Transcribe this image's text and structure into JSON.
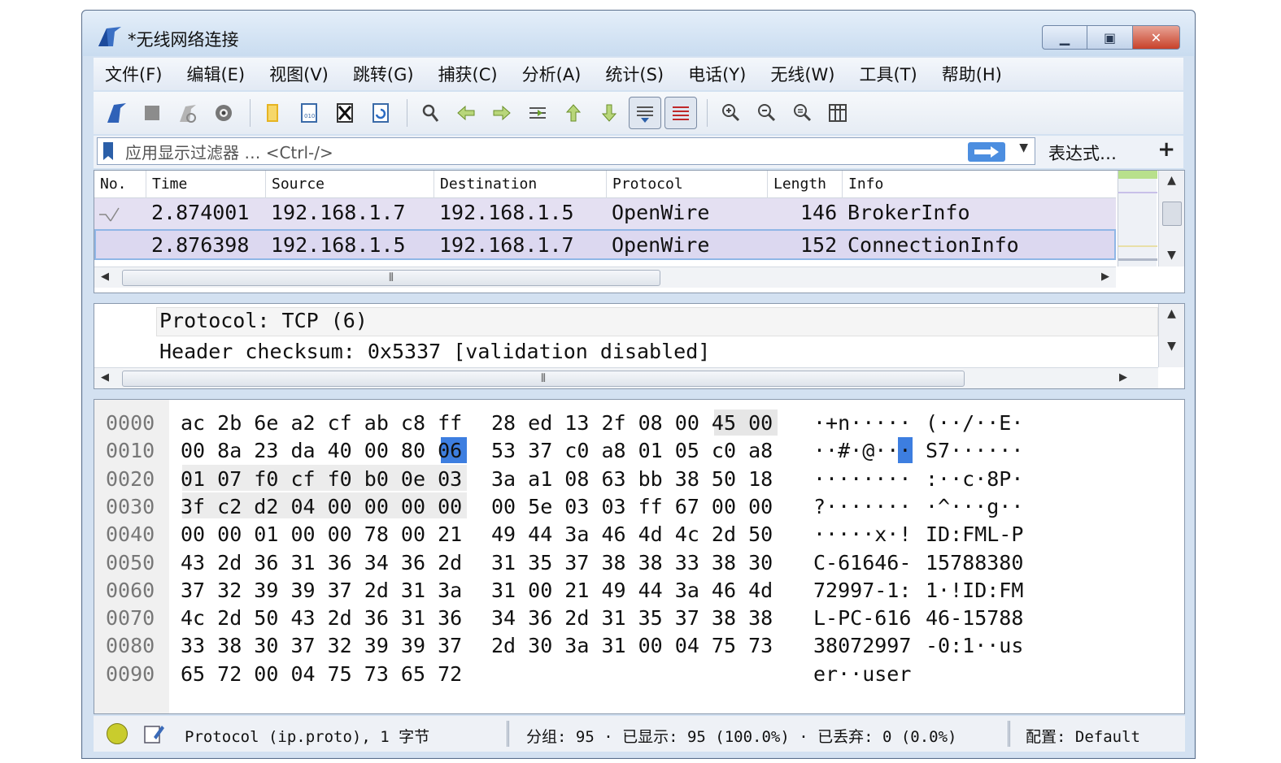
{
  "window": {
    "title": "*无线网络连接"
  },
  "menu": [
    "文件(F)",
    "编辑(E)",
    "视图(V)",
    "跳转(G)",
    "捕获(C)",
    "分析(A)",
    "统计(S)",
    "电话(Y)",
    "无线(W)",
    "工具(T)",
    "帮助(H)"
  ],
  "toolbar": {
    "buttons": [
      "start-capture-icon",
      "stop-capture-icon",
      "restart-capture-icon",
      "capture-options-icon",
      "open-file-icon",
      "save-file-icon",
      "close-file-icon",
      "reload-icon",
      "find-packet-icon",
      "go-back-icon",
      "go-forward-icon",
      "go-to-packet-icon",
      "go-first-icon",
      "go-last-icon",
      "autoscroll-icon",
      "colorize-icon",
      "zoom-in-icon",
      "zoom-out-icon",
      "zoom-normal-icon",
      "resize-columns-icon"
    ]
  },
  "filter": {
    "placeholder": "应用显示过滤器 … <Ctrl-/>",
    "expression_label": "表达式…",
    "plus_label": "+"
  },
  "packet_list": {
    "columns": [
      "No.",
      "Time",
      "Source",
      "Destination",
      "Protocol",
      "Length",
      "Info"
    ],
    "rows": [
      {
        "time": "2.874001",
        "source": "192.168.1.7",
        "destination": "192.168.1.5",
        "protocol": "OpenWire",
        "length": "146",
        "info": "BrokerInfo"
      },
      {
        "time": "2.876398",
        "source": "192.168.1.5",
        "destination": "192.168.1.7",
        "protocol": "OpenWire",
        "length": "152",
        "info": "ConnectionInfo"
      }
    ]
  },
  "details": {
    "lines": [
      "Protocol: TCP (6)",
      "Header checksum: 0x5337 [validation disabled]"
    ]
  },
  "bytes": {
    "rows": [
      {
        "offset": "0000",
        "hex1": "ac 2b 6e a2 cf ab c8 ff",
        "hex2": "28 ed 13 2f 08 00 45 00",
        "ascii1": "·+n·····",
        "ascii2": "(··/··E·"
      },
      {
        "offset": "0010",
        "hex1": "00 8a 23 da 40 00 80 06",
        "hex2": "53 37 c0 a8 01 05 c0 a8",
        "ascii1": "··#·@···",
        "ascii2": "S7······"
      },
      {
        "offset": "0020",
        "hex1": "01 07 f0 cf f0 b0 0e 03",
        "hex2": "3a a1 08 63 bb 38 50 18",
        "ascii1": "········",
        "ascii2": ":··c·8P·"
      },
      {
        "offset": "0030",
        "hex1": "3f c2 d2 04 00 00 00 00",
        "hex2": "00 5e 03 03 ff 67 00 00",
        "ascii1": "?·······",
        "ascii2": "·^···g··"
      },
      {
        "offset": "0040",
        "hex1": "00 00 01 00 00 78 00 21",
        "hex2": "49 44 3a 46 4d 4c 2d 50",
        "ascii1": "·····x·!",
        "ascii2": "ID:FML-P"
      },
      {
        "offset": "0050",
        "hex1": "43 2d 36 31 36 34 36 2d",
        "hex2": "31 35 37 38 38 33 38 30",
        "ascii1": "C-61646-",
        "ascii2": "15788380"
      },
      {
        "offset": "0060",
        "hex1": "37 32 39 39 37 2d 31 3a",
        "hex2": "31 00 21 49 44 3a 46 4d",
        "ascii1": "72997-1:",
        "ascii2": "1·!ID:FM"
      },
      {
        "offset": "0070",
        "hex1": "4c 2d 50 43 2d 36 31 36",
        "hex2": "34 36 2d 31 35 37 38 38",
        "ascii1": "L-PC-616",
        "ascii2": "46-15788"
      },
      {
        "offset": "0080",
        "hex1": "33 38 30 37 32 39 39 37",
        "hex2": "2d 30 3a 31 00 04 75 73",
        "ascii1": "38072997",
        "ascii2": "-0:1··us"
      },
      {
        "offset": "0090",
        "hex1": "65 72 00 04 75 73 65 72",
        "hex2": "",
        "ascii1": "er··user",
        "ascii2": ""
      }
    ]
  },
  "status": {
    "field": "Protocol (ip.proto), 1 字节",
    "packets": "分组: 95 · 已显示: 95 (100.0%) · 已丢弃: 0 (0.0%)",
    "profile": "配置: Default"
  },
  "colors": {
    "row_bg": "#e4e0f2",
    "selected_border": "#8fb6e6",
    "highlight": "#3d7ee0"
  }
}
